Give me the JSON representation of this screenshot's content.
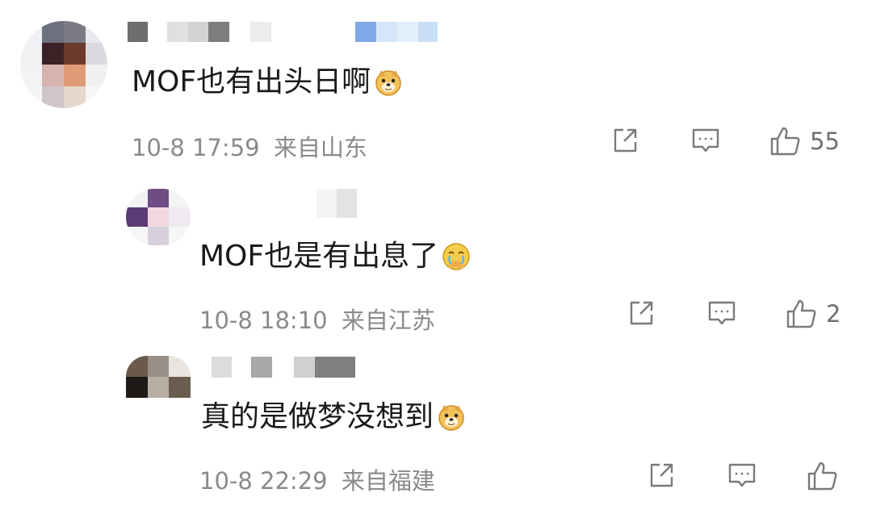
{
  "comments": [
    {
      "avatar_name": "user-avatar-1",
      "text": "MOF也有出头日啊",
      "emoji": "doge-emoji",
      "time": "10-8 17:59",
      "location": "来自山东",
      "likes": "55"
    },
    {
      "avatar_name": "user-avatar-2",
      "text": "MOF也是有出息了",
      "emoji": "tearful-face-emoji",
      "time": "10-8 18:10",
      "location": "来自江苏",
      "likes": "2"
    },
    {
      "avatar_name": "user-avatar-3",
      "text": "真的是做梦没想到",
      "emoji": "doge-emoji",
      "time": "10-8 22:29",
      "location": "来自福建",
      "likes": ""
    }
  ],
  "icons": {
    "share": "share-icon",
    "comment": "comment-icon",
    "like": "thumbs-up-icon"
  },
  "colors": {
    "text": "#1a1a1a",
    "meta": "#8a8a8a",
    "icon": "#7a7a7a"
  }
}
